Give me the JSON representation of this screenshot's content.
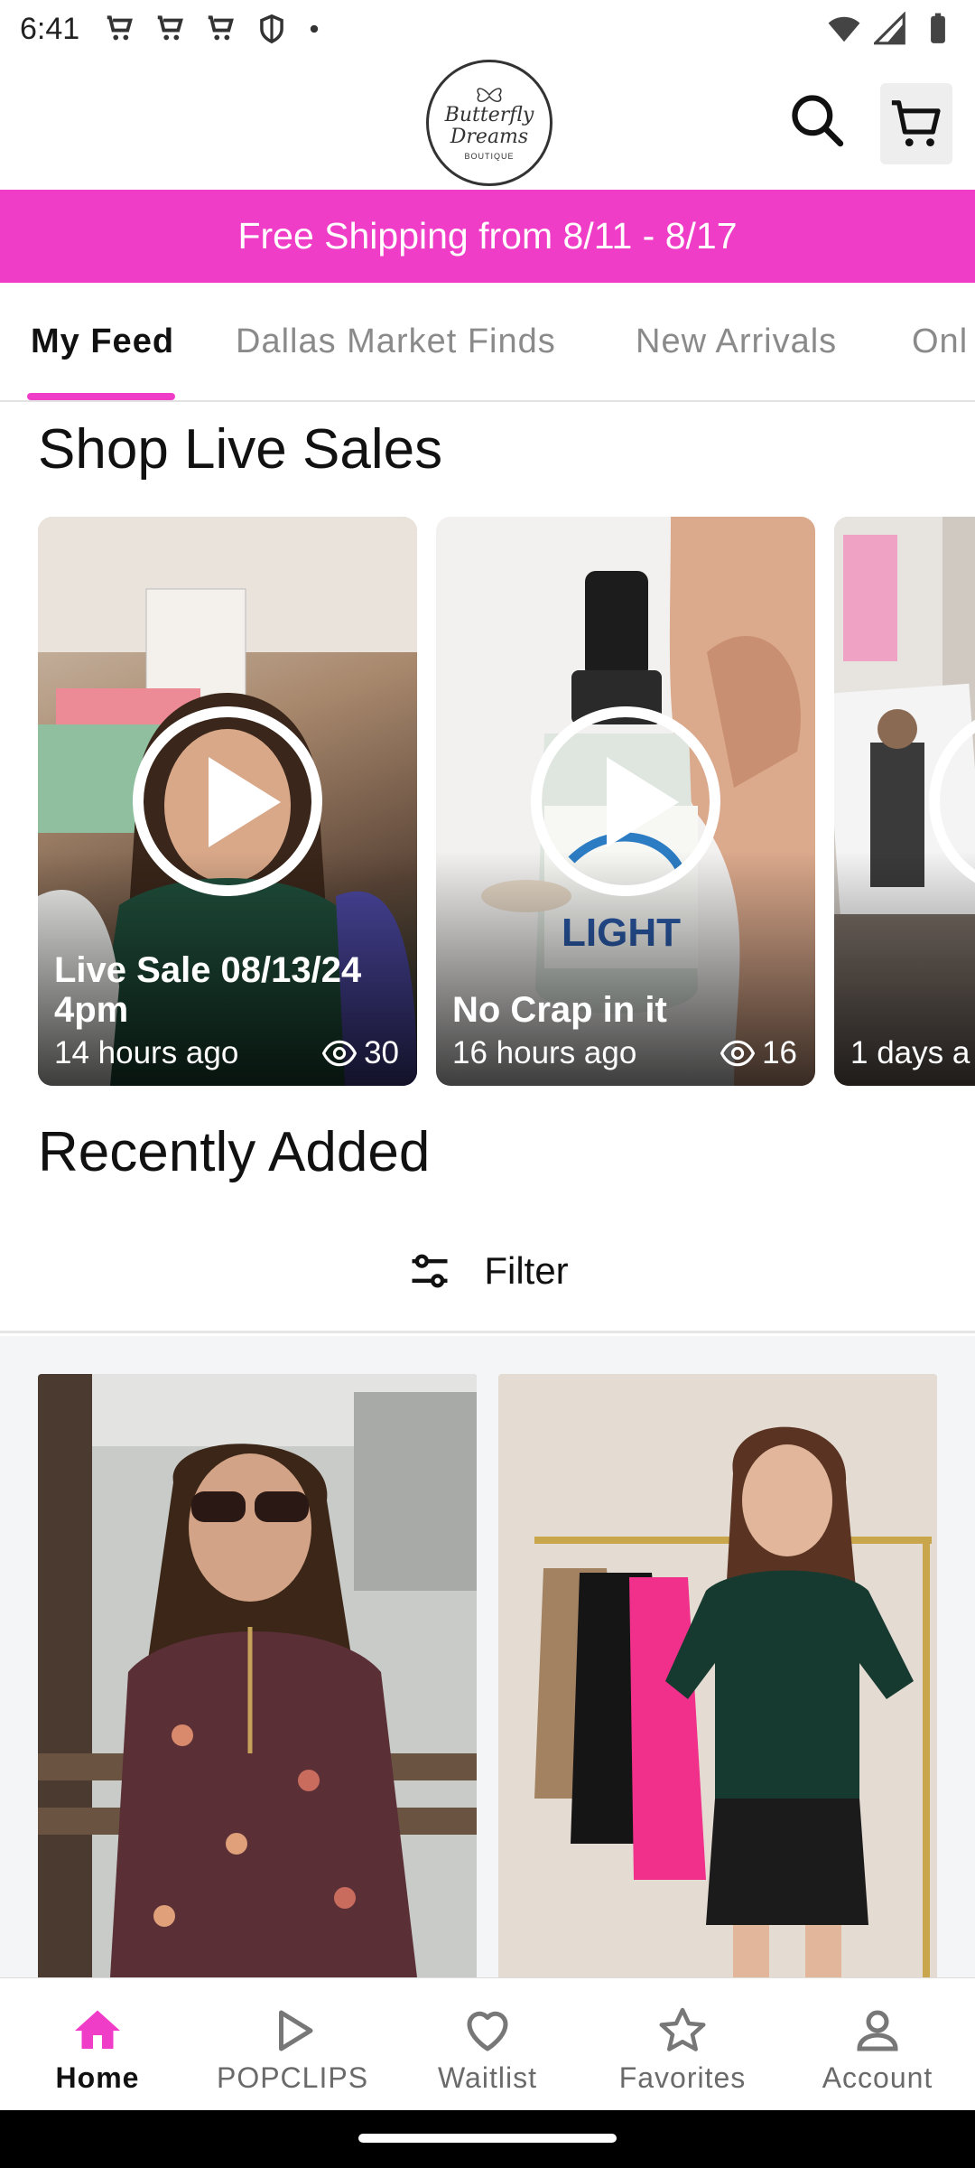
{
  "status_bar": {
    "time": "6:41"
  },
  "header": {
    "logo_script": "Butterfly Dreams",
    "logo_sub": "BOUTIQUE"
  },
  "promo": {
    "text": "Free Shipping from 8/11 - 8/17"
  },
  "tabs": [
    {
      "label": "My Feed",
      "active": true
    },
    {
      "label": "Dallas Market Finds"
    },
    {
      "label": "New Arrivals"
    },
    {
      "label": "Onl"
    }
  ],
  "live_section": {
    "title": "Shop Live Sales",
    "cards": [
      {
        "title": "Live Sale 08/13/24 4pm",
        "time": "14 hours ago",
        "views": "30"
      },
      {
        "title": "No Crap in it",
        "time": "16 hours ago",
        "views": "16"
      },
      {
        "title": "",
        "time": "1 days a",
        "views": ""
      }
    ]
  },
  "recent_section": {
    "title": "Recently Added",
    "filter_label": "Filter"
  },
  "bottom_nav": [
    {
      "label": "Home",
      "icon": "home-icon",
      "active": true
    },
    {
      "label": "POPCLIPS",
      "icon": "play-icon"
    },
    {
      "label": "Waitlist",
      "icon": "heart-icon"
    },
    {
      "label": "Favorites",
      "icon": "star-icon"
    },
    {
      "label": "Account",
      "icon": "person-icon"
    }
  ],
  "colors": {
    "accent": "#f03dc8"
  }
}
